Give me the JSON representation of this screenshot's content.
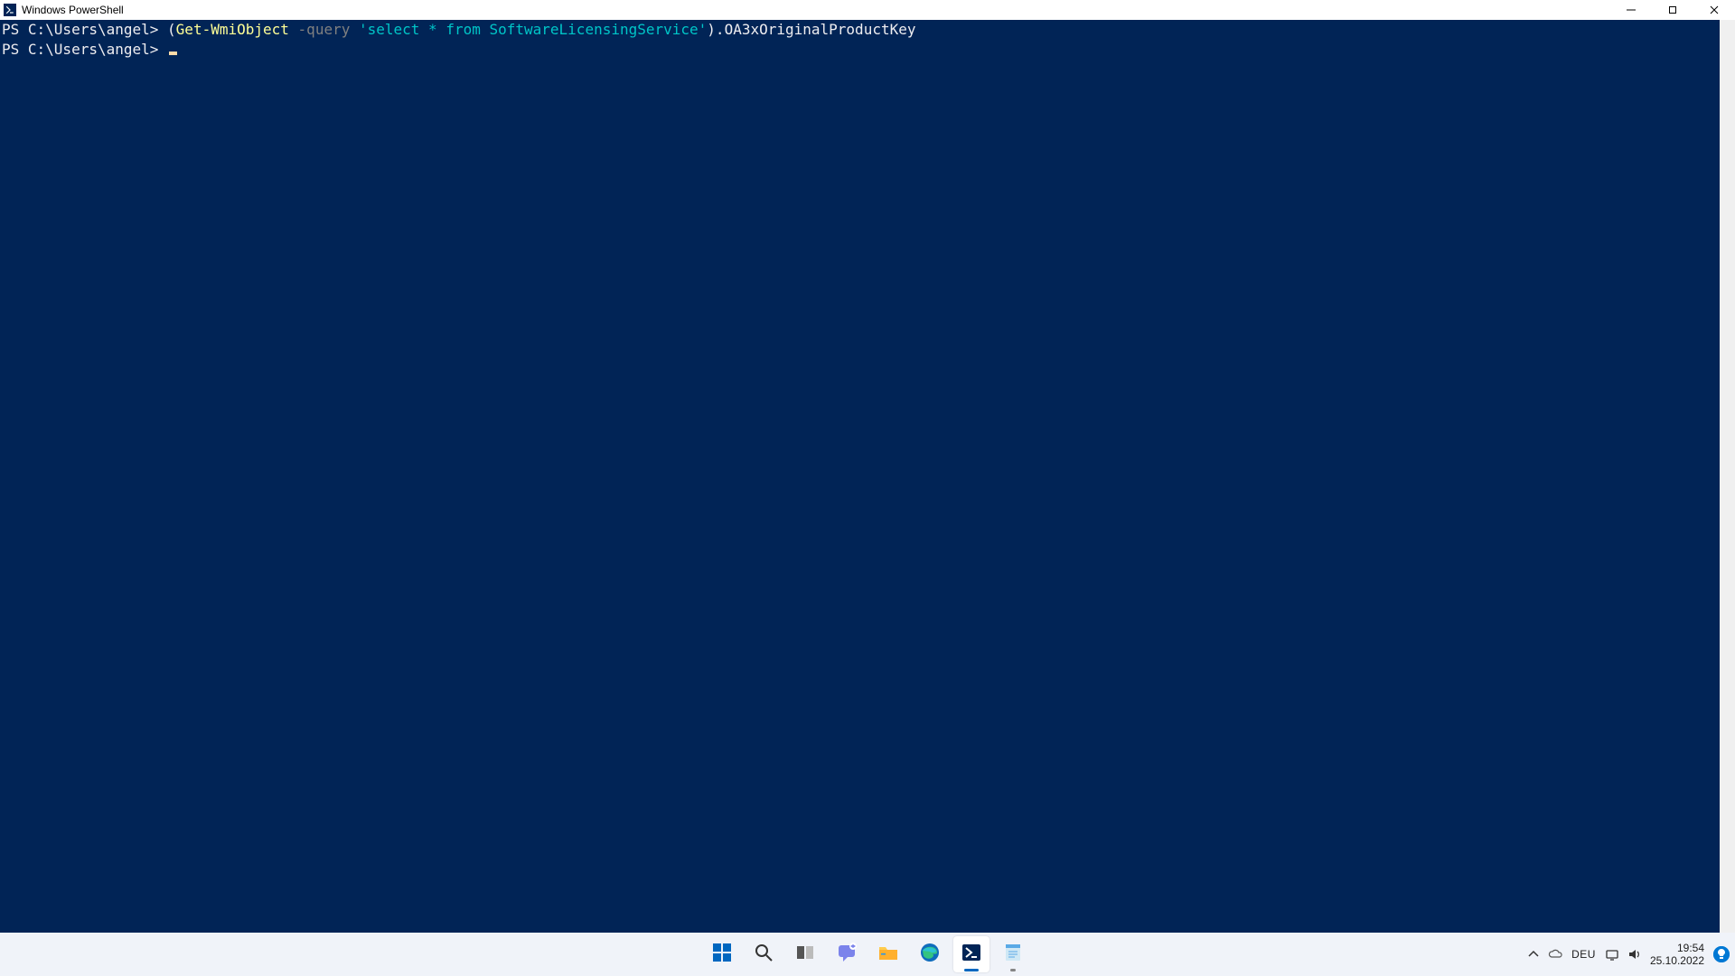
{
  "window": {
    "title": "Windows PowerShell"
  },
  "terminal": {
    "line1": {
      "prompt": "PS C:\\Users\\angel> ",
      "seg_open": "(",
      "seg_cmdlet": "Get-WmiObject",
      "seg_space1": " ",
      "seg_param": "-query",
      "seg_space2": " ",
      "seg_string": "'select * from SoftwareLicensingService'",
      "seg_close": ").OA3xOriginalProductKey"
    },
    "line2": {
      "prompt": "PS C:\\Users\\angel> "
    }
  },
  "taskbar": {},
  "tray": {
    "lang": "DEU",
    "time": "19:54",
    "date": "25.10.2022"
  }
}
